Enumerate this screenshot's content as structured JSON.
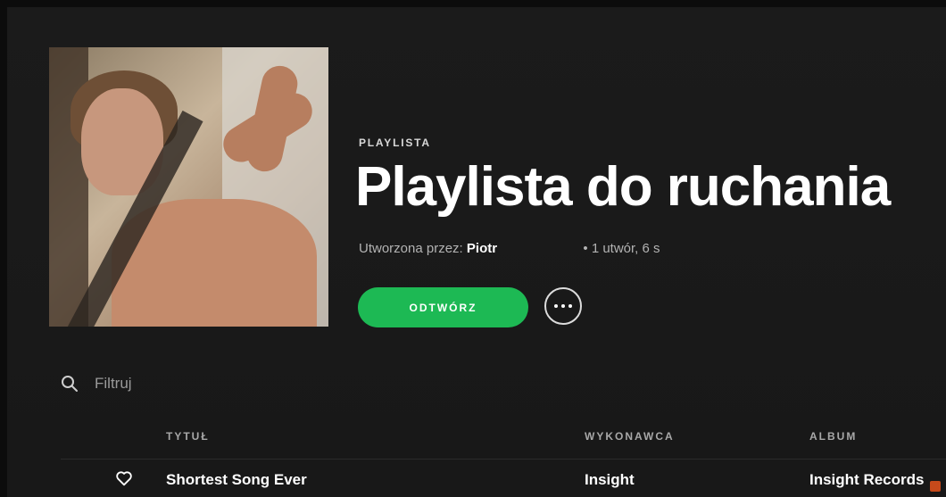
{
  "header": {
    "type_label": "PLAYLISTA",
    "title": "Playlista do ruchania",
    "meta_prefix": "Utworzona przez:",
    "owner": "Piotr",
    "meta_suffix": "• 1 utwór, 6 s"
  },
  "actions": {
    "play_label": "ODTWÓRZ",
    "more_icon": "more-icon"
  },
  "filter": {
    "placeholder": "Filtruj",
    "icon": "search-icon"
  },
  "table": {
    "columns": [
      "TYTUŁ",
      "WYKONAWCA",
      "ALBUM"
    ],
    "rows": [
      {
        "title": "Shortest Song Ever",
        "artist": "Insight",
        "album": "Insight Records"
      }
    ]
  },
  "colors": {
    "background": "#181818",
    "accent": "#1db954",
    "text": "#ffffff",
    "muted": "#b3b3b3"
  }
}
